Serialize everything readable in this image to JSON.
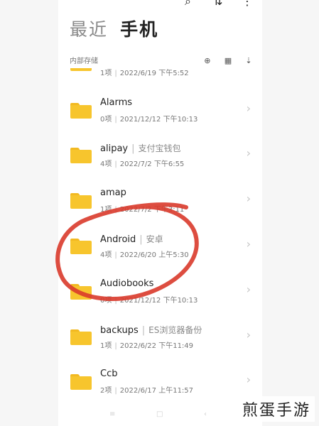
{
  "header": {
    "tab_recent": "最近",
    "tab_phone": "手机",
    "storage_label": "内部存储"
  },
  "partial_row": {
    "count": "1项",
    "date": "2022/6/19 下午5:52"
  },
  "folders": [
    {
      "name": "Alarms",
      "alias": "",
      "count": "0项",
      "date": "2021/12/12 下午10:13"
    },
    {
      "name": "alipay",
      "alias": "支付宝钱包",
      "count": "4项",
      "date": "2022/7/2 下午6:55"
    },
    {
      "name": "amap",
      "alias": "",
      "count": "1项",
      "date": "2022/7/2 下午3:11"
    },
    {
      "name": "Android",
      "alias": "安卓",
      "count": "4项",
      "date": "2022/6/20 上午5:30"
    },
    {
      "name": "Audiobooks",
      "alias": "",
      "count": "0项",
      "date": "2021/12/12 下午10:13"
    },
    {
      "name": "backups",
      "alias": "ES浏览器备份",
      "count": "1项",
      "date": "2022/6/22 下午11:49"
    },
    {
      "name": "Ccb",
      "alias": "",
      "count": "2项",
      "date": "2022/6/17 上午11:57"
    }
  ],
  "watermark": "煎蛋手游",
  "colors": {
    "folder": "#f7c52d",
    "circle": "#d93a2b"
  }
}
